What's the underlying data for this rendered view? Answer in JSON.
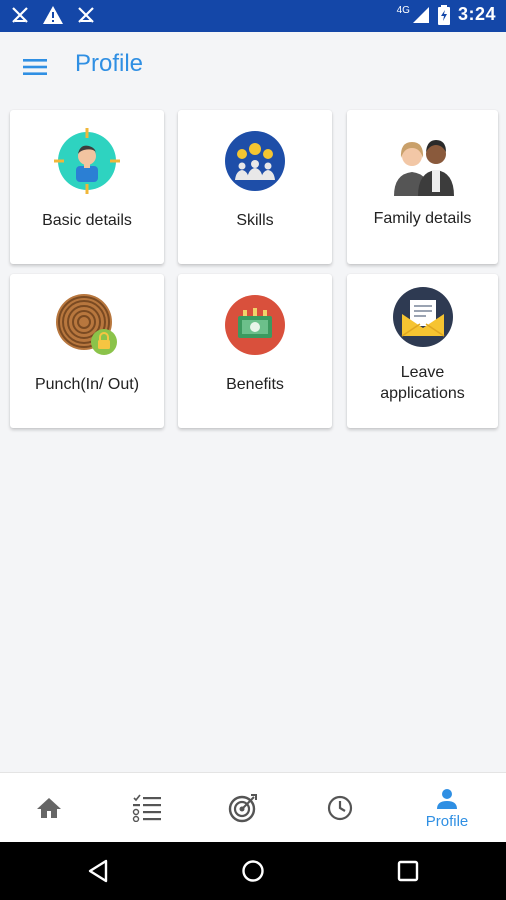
{
  "status_bar": {
    "time": "3:24",
    "network": "4G"
  },
  "app_bar": {
    "title": "Profile"
  },
  "tiles": [
    {
      "label": "Basic details",
      "icon": "user-focus-icon"
    },
    {
      "label": "Skills",
      "icon": "lightbulb-team-icon"
    },
    {
      "label": "Family details",
      "icon": "couple-icon"
    },
    {
      "label": "Punch(In/ Out)",
      "icon": "fingerprint-lock-icon"
    },
    {
      "label": "Benefits",
      "icon": "money-icon"
    },
    {
      "label": "Leave applications",
      "label_line1": "Leave",
      "label_line2": "applications",
      "icon": "envelope-letter-icon"
    }
  ],
  "bottom_nav": {
    "items": [
      {
        "icon": "home-icon",
        "label": ""
      },
      {
        "icon": "checklist-icon",
        "label": ""
      },
      {
        "icon": "target-icon",
        "label": ""
      },
      {
        "icon": "clock-icon",
        "label": ""
      },
      {
        "icon": "person-icon",
        "label": "Profile",
        "active": true
      }
    ],
    "active_color": "#2f8fe3",
    "inactive_color": "#666666"
  },
  "colors": {
    "status_bar": "#1447a8",
    "accent": "#2f8fe3",
    "background": "#f4f5f7"
  }
}
